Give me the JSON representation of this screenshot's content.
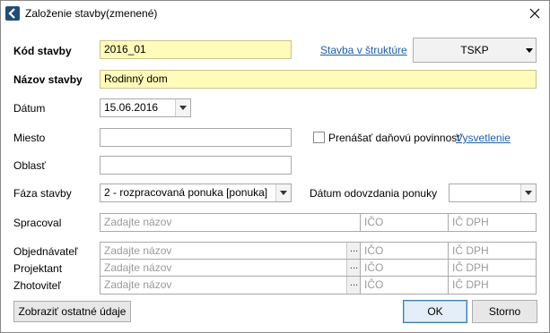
{
  "window": {
    "title": "Založenie stavby(zmenené)"
  },
  "icons": {
    "app": "back-arrow-icon",
    "close": "close-icon"
  },
  "form": {
    "kod_stavby": {
      "label": "Kód stavby",
      "value": "2016_01"
    },
    "nazov_stavby": {
      "label": "Názov stavby",
      "value": "Rodinný dom"
    },
    "datum": {
      "label": "Dátum",
      "value": "15.06.2016"
    },
    "miesto": {
      "label": "Miesto",
      "value": ""
    },
    "oblast": {
      "label": "Oblasť",
      "value": ""
    },
    "faza_stavby": {
      "label": "Fáza stavby",
      "value": "2 - rozpracovaná ponuka [ponuka]"
    },
    "datum_odovzdania": {
      "label": "Dátum odovzdania ponuky",
      "value": ""
    },
    "stavba_v_strukture": "Stavba v štruktúre",
    "tskp": "TSKP",
    "prenasat": "Prenášať daňovú povinnosť",
    "prenasat_checked": false,
    "vysvetlenie": "Vysvetlenie"
  },
  "parties": {
    "name_placeholder": "Zadajte názov",
    "ico_placeholder": "IČO",
    "icdph_placeholder": "IČ DPH",
    "spracoval": "Spracoval",
    "objednavatel": "Objednávateľ",
    "projektant": "Projektant",
    "zhotovitel": "Zhotoviteľ",
    "dots": "..."
  },
  "buttons": {
    "ostatne": "Zobraziť ostatné údaje",
    "ok": "OK",
    "storno": "Storno"
  }
}
